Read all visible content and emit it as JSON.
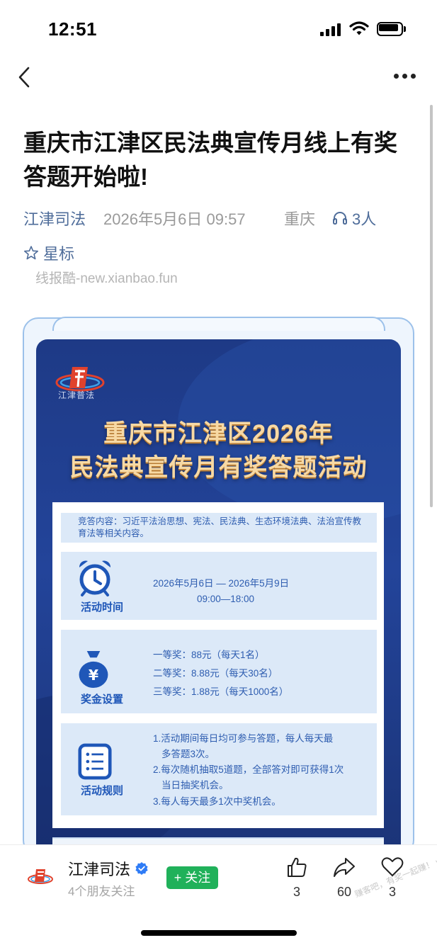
{
  "status_bar": {
    "time": "12:51"
  },
  "article": {
    "title": "重庆市江津区民法典宣传月线上有奖答题开始啦!",
    "author": "江津司法",
    "date": "2026年5月6日 09:57",
    "region": "重庆",
    "listeners": "3人",
    "star_label": "星标",
    "watermark": "线报酷-new.xianbao.fun"
  },
  "poster": {
    "logo_text": "江津普法",
    "title_line1": "重庆市江津区2026年",
    "title_line2": "民法典宣传月有奖答题活动",
    "intro": "竞答内容：习近平法治思想、宪法、民法典、生态环境法典、法治宣传教育法等相关内容。",
    "time_block": {
      "label": "活动时间",
      "line1": "2026年5月6日 — 2026年5月9日",
      "line2": "09:00—18:00"
    },
    "prize_block": {
      "label": "奖金设置",
      "lines": [
        "一等奖：88元（每天1名）",
        "二等奖：8.88元（每天30名）",
        "三等奖：1.88元（每天1000名）"
      ]
    },
    "rules_block": {
      "label": "活动规则",
      "lines": [
        "1.活动期间每日均可参与答题，每人每天最",
        "多答题3次。",
        "2.每次随机抽取5道题，全部答对即可获得1次",
        "当日抽奖机会。",
        "3.每人每天最多1次中奖机会。"
      ]
    }
  },
  "bottom_bar": {
    "author_name": "江津司法",
    "followers": "4个朋友关注",
    "follow_label": "+ 关注",
    "like_count": "3",
    "share_count": "60",
    "favorite_count": "3",
    "site_watermark": "赚客吧，有奖一起赚！ www.zuanke8.com"
  },
  "colors": {
    "link_blue": "#4f6d9a",
    "poster_navy": "#1e3a86",
    "poster_gold": "#f7d9a4",
    "follow_green": "#20b15a"
  },
  "icons": [
    "back-icon",
    "more-icon",
    "headphone-icon",
    "star-icon",
    "alarm-clock-icon",
    "money-bag-icon",
    "rules-list-icon",
    "verified-icon",
    "like-icon",
    "share-icon",
    "favorite-icon"
  ]
}
